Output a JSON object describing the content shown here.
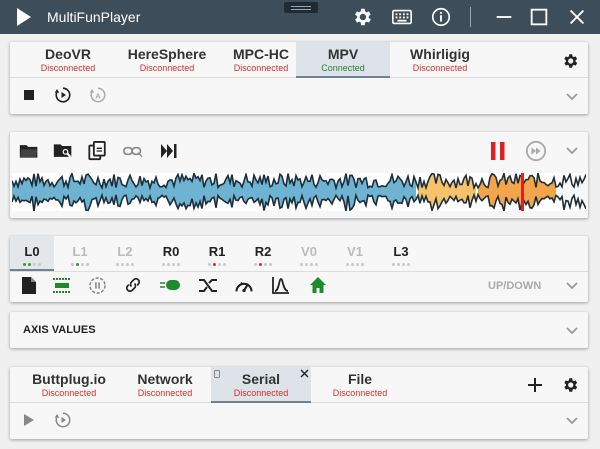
{
  "app": {
    "title": "MultiFunPlayer"
  },
  "titlebar": {
    "icons": [
      "play-icon",
      "settings-icon",
      "keyboard-icon",
      "info-icon",
      "minimize-icon",
      "maximize-icon",
      "close-icon"
    ]
  },
  "players": {
    "tabs": [
      {
        "name": "DeoVR",
        "status": "Disconnected"
      },
      {
        "name": "HereSphere",
        "status": "Disconnected"
      },
      {
        "name": "MPC-HC",
        "status": "Disconnected"
      },
      {
        "name": "MPV",
        "status": "Connected"
      },
      {
        "name": "Whirligig",
        "status": "Disconnected"
      }
    ],
    "active": "MPV"
  },
  "script": {
    "icons": [
      "open-folder-icon",
      "search-folder-icon",
      "copy-icon",
      "link-icon",
      "skip-next-icon",
      "pause-icon",
      "fast-forward-icon"
    ]
  },
  "axes": {
    "items": [
      {
        "name": "L0",
        "dots": [
          "g",
          "g",
          "",
          ""
        ]
      },
      {
        "name": "L1",
        "dots": [
          "",
          "g",
          "",
          ""
        ]
      },
      {
        "name": "L2",
        "dots": [
          "",
          "",
          "",
          ""
        ]
      },
      {
        "name": "R0",
        "dots": [
          "",
          "",
          "",
          ""
        ]
      },
      {
        "name": "R1",
        "dots": [
          "",
          "r",
          "",
          ""
        ]
      },
      {
        "name": "R2",
        "dots": [
          "",
          "r",
          "",
          ""
        ]
      },
      {
        "name": "V0",
        "dots": [
          "",
          "",
          "",
          ""
        ]
      },
      {
        "name": "V1",
        "dots": [
          "",
          "",
          "",
          ""
        ]
      },
      {
        "name": "L3",
        "dots": [
          "",
          "",
          "",
          ""
        ]
      }
    ],
    "selected": "L0",
    "mode_label": "UP/DOWN",
    "values_label": "AXIS VALUES"
  },
  "outputs": {
    "tabs": [
      {
        "name": "Buttplug.io",
        "status": "Disconnected"
      },
      {
        "name": "Network",
        "status": "Disconnected"
      },
      {
        "name": "Serial",
        "status": "Disconnected"
      },
      {
        "name": "File",
        "status": "Disconnected"
      }
    ],
    "active": "Serial"
  },
  "colors": {
    "titlebar": "#3d4d59",
    "accent_red": "#e02020",
    "green": "#1e8a2e",
    "wave_blue": "#6fb3d2",
    "wave_orange": "#f2a54a"
  }
}
